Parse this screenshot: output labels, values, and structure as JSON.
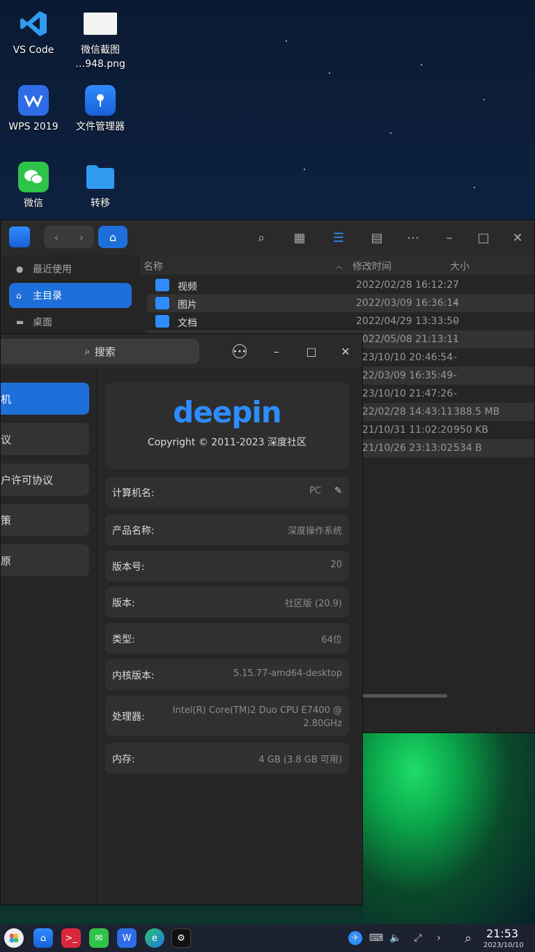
{
  "desktop": {
    "icons": [
      {
        "label": "VS Code"
      },
      {
        "label": "微信截图",
        "label2": "…948.png"
      },
      {
        "label": "WPS 2019"
      },
      {
        "label": "文件管理器"
      },
      {
        "label": "微信"
      },
      {
        "label": "转移"
      }
    ]
  },
  "file_manager": {
    "sidebar": [
      {
        "label": "最近使用",
        "icon": "clock-icon"
      },
      {
        "label": "主目录",
        "icon": "home-icon"
      },
      {
        "label": "桌面",
        "icon": "desktop-icon"
      }
    ],
    "columns": {
      "name": "名称",
      "modified": "修改时间",
      "size": "大小"
    },
    "rows": [
      {
        "name": "视频",
        "time": "2022/02/28 16:12:27",
        "size": "-"
      },
      {
        "name": "图片",
        "time": "2022/03/09 16:36:14",
        "size": "-"
      },
      {
        "name": "文档",
        "time": "2022/04/29 13:33:50",
        "size": "-"
      },
      {
        "name": "",
        "time": "2022/05/08 21:13:11",
        "size": "-"
      },
      {
        "name": "",
        "time": "023/10/10 20:46:54",
        "size": "-"
      },
      {
        "name": "",
        "time": "022/03/09 16:35:49",
        "size": "-"
      },
      {
        "name": "",
        "time": "023/10/10 21:47:26",
        "size": "-"
      },
      {
        "name": "",
        "time": "022/02/28 14:43:11",
        "size": "388.5 MB"
      },
      {
        "name": "",
        "time": "021/10/31 11:02:20",
        "size": "950 KB"
      },
      {
        "name": "",
        "time": "021/10/26 23:13:02",
        "size": "534 B"
      }
    ]
  },
  "system_info": {
    "search_placeholder": "搜索",
    "nav": [
      {
        "label": "机"
      },
      {
        "label": "议"
      },
      {
        "label": "户许可协议"
      },
      {
        "label": "策"
      },
      {
        "label": "原"
      }
    ],
    "brand": "deepin",
    "copyright": "Copyright © 2011-2023 深度社区",
    "rows": [
      {
        "key": "计算机名:",
        "value": "PC"
      },
      {
        "key": "产品名称:",
        "value": "深度操作系统"
      },
      {
        "key": "版本号:",
        "value": "20"
      },
      {
        "key": "版本:",
        "value": "社区版 (20.9)"
      },
      {
        "key": "类型:",
        "value": "64位"
      },
      {
        "key": "内核版本:",
        "value": "5.15.77-amd64-desktop"
      },
      {
        "key": "处理器:",
        "value": "Intel(R) Core(TM)2 Duo CPU    E7400 @",
        "value2": "2.80GHz"
      },
      {
        "key": "内存:",
        "value": "4 GB (3.8 GB 可用)"
      }
    ]
  },
  "taskbar": {
    "time": "21:53",
    "date": "2023/10/10"
  }
}
